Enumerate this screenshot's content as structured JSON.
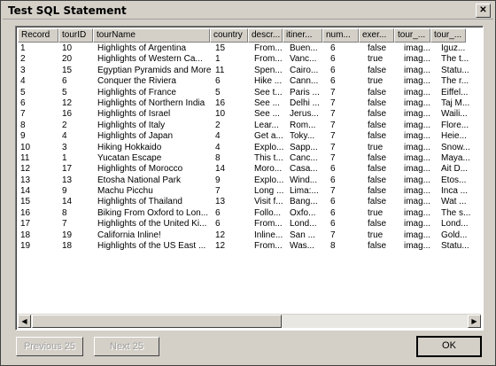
{
  "window": {
    "title": "Test SQL Statement",
    "close_glyph": "✕"
  },
  "table": {
    "columns": [
      "Record",
      "tourID",
      "tourName",
      "country",
      "descr...",
      "itiner...",
      "num...",
      "exer...",
      "tour_...",
      "tour_..."
    ],
    "rows": [
      [
        "1",
        "10",
        "Highlights of Argentina",
        "15",
        "From...",
        "Buen...",
        "6",
        "false",
        "imag...",
        "Iguz..."
      ],
      [
        "2",
        "20",
        "Highlights of Western Ca...",
        "1",
        "From...",
        "Vanc...",
        "6",
        "true",
        "imag...",
        "The t..."
      ],
      [
        "3",
        "15",
        "Egyptian Pyramids and More",
        "11",
        "Spen...",
        "Cairo...",
        "6",
        "false",
        "imag...",
        "Statu..."
      ],
      [
        "4",
        "6",
        "Conquer the Riviera",
        "6",
        "Hike ...",
        "Cann...",
        "6",
        "true",
        "imag...",
        "The r..."
      ],
      [
        "5",
        "5",
        "Highlights of France",
        "5",
        "See t...",
        "Paris ...",
        "7",
        "false",
        "imag...",
        "Eiffel..."
      ],
      [
        "6",
        "12",
        "Highlights of Northern India",
        "16",
        "See ...",
        "Delhi ...",
        "7",
        "false",
        "imag...",
        "Taj M..."
      ],
      [
        "7",
        "16",
        "Highlights of Israel",
        "10",
        "See ...",
        "Jerus...",
        "7",
        "false",
        "imag...",
        "Waili..."
      ],
      [
        "8",
        "2",
        "Highlights of Italy",
        "2",
        "Lear...",
        "Rom...",
        "7",
        "false",
        "imag...",
        "Flore..."
      ],
      [
        "9",
        "4",
        "Highlights of Japan",
        "4",
        "Get a...",
        "Toky...",
        "7",
        "false",
        "imag...",
        "Heie..."
      ],
      [
        "10",
        "3",
        "Hiking Hokkaido",
        "4",
        "Explo...",
        "Sapp...",
        "7",
        "true",
        "imag...",
        "Snow..."
      ],
      [
        "11",
        "1",
        "Yucatan Escape",
        "8",
        "This t...",
        "Canc...",
        "7",
        "false",
        "imag...",
        "Maya..."
      ],
      [
        "12",
        "17",
        "Highlights of Morocco",
        "14",
        "Moro...",
        "Casa...",
        "6",
        "false",
        "imag...",
        "Ait D..."
      ],
      [
        "13",
        "13",
        "Etosha National Park",
        "9",
        "Explo...",
        "Wind...",
        "6",
        "false",
        "imag...",
        "Etos..."
      ],
      [
        "14",
        "9",
        "Machu Picchu",
        "7",
        "Long ...",
        "Lima:...",
        "7",
        "false",
        "imag...",
        "Inca ..."
      ],
      [
        "15",
        "14",
        "Highlights of Thailand",
        "13",
        "Visit f...",
        "Bang...",
        "6",
        "false",
        "imag...",
        "Wat ..."
      ],
      [
        "16",
        "8",
        "Biking From Oxford to Lon...",
        "6",
        "Follo...",
        "Oxfo...",
        "6",
        "true",
        "imag...",
        "The s..."
      ],
      [
        "17",
        "7",
        "Highlights of the United Ki...",
        "6",
        "From...",
        "Lond...",
        "6",
        "false",
        "imag...",
        "Lond..."
      ],
      [
        "18",
        "19",
        "California Inline!",
        "12",
        "Inline...",
        "San ...",
        "7",
        "true",
        "imag...",
        "Gold..."
      ],
      [
        "19",
        "18",
        "Highlights of the US East ...",
        "12",
        "From...",
        "Was...",
        "8",
        "false",
        "imag...",
        "Statu..."
      ]
    ]
  },
  "scrollbar": {
    "left_glyph": "◀",
    "right_glyph": "▶"
  },
  "buttons": {
    "previous": "Previous 25",
    "next": "Next 25",
    "ok": "OK"
  }
}
